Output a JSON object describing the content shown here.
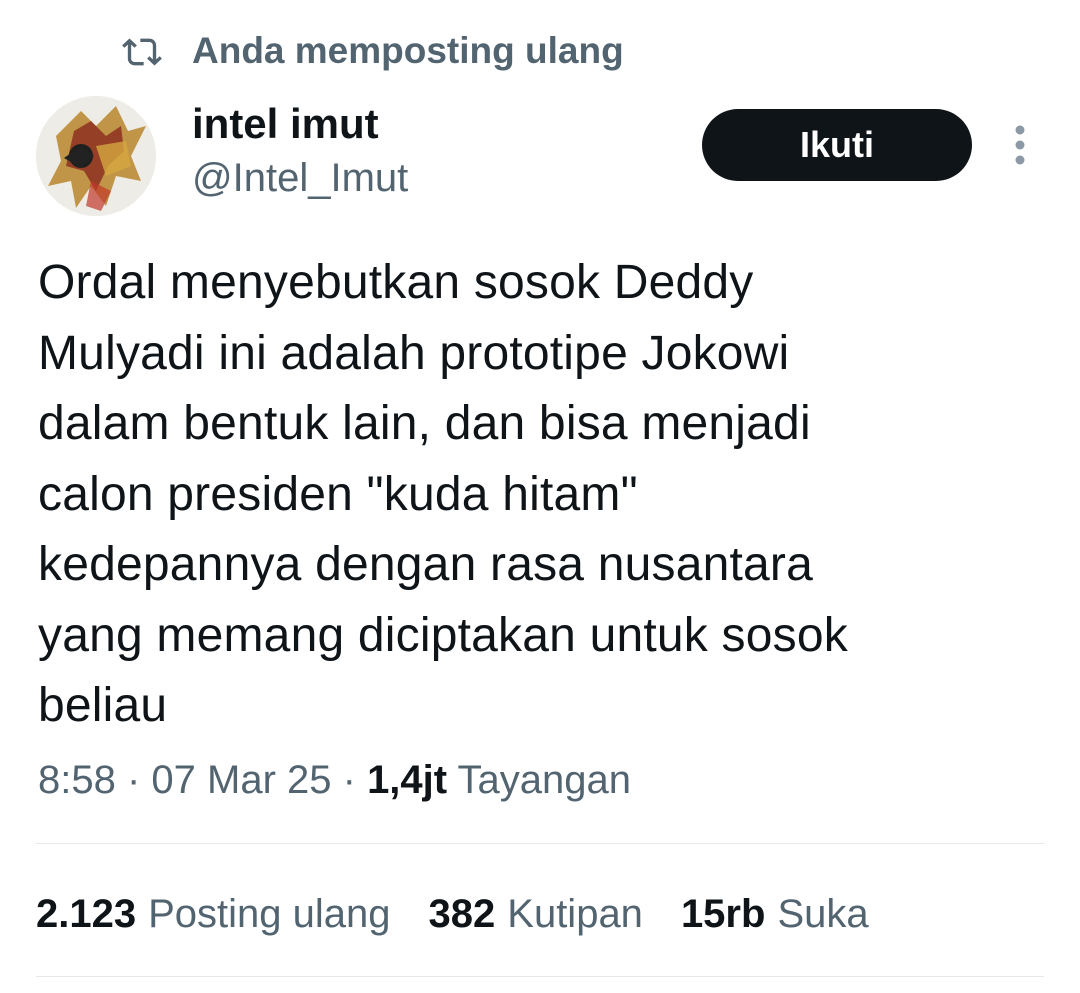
{
  "repost_banner": {
    "text": "Anda memposting ulang",
    "icon": "repost-icon"
  },
  "author": {
    "display_name": "intel imut",
    "handle": "@Intel_Imut",
    "avatar": "wayang-avatar"
  },
  "follow_button": {
    "label": "Ikuti"
  },
  "more_button": {
    "icon": "more-vertical-icon"
  },
  "tweet": {
    "lines": [
      "Ordal menyebutkan sosok Deddy",
      "Mulyadi ini adalah prototipe Jokowi",
      "dalam bentuk lain, dan bisa menjadi",
      "calon presiden \"kuda hitam\"",
      "kedepannya dengan rasa nusantara",
      "yang memang diciptakan untuk sosok",
      "beliau"
    ]
  },
  "meta": {
    "time": "8:58",
    "separator": " · ",
    "date": "07 Mar 25",
    "views_count": "1,4jt",
    "views_label": "Tayangan"
  },
  "stats": {
    "reposts": {
      "count": "2.123",
      "label": "Posting ulang"
    },
    "quotes": {
      "count": "382",
      "label": "Kutipan"
    },
    "likes": {
      "count": "15rb",
      "label": "Suka"
    }
  },
  "colors": {
    "text_primary": "#0f1419",
    "text_secondary": "#536471",
    "button_bg": "#0f1419",
    "divider": "#e6e9ec"
  }
}
